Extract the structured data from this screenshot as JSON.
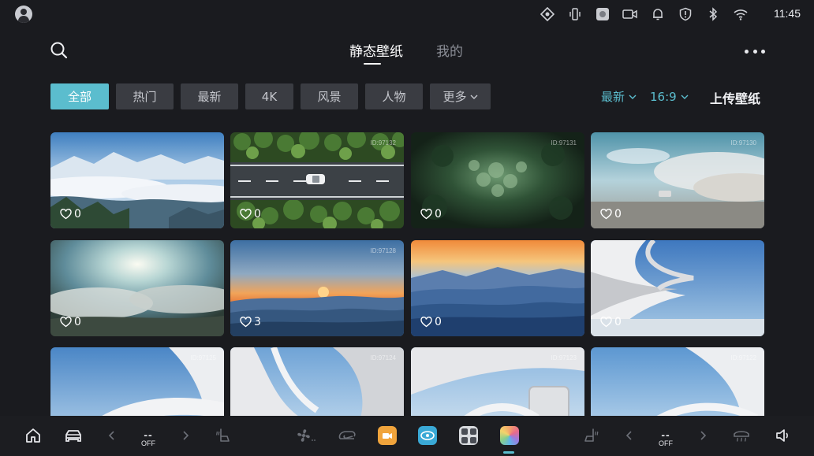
{
  "statusbar": {
    "time": "11:45",
    "icons": [
      "location-diamond-icon",
      "phone-vibrate-icon",
      "media-app-icon",
      "camera-record-icon",
      "bell-icon",
      "shield-alert-icon",
      "bluetooth-icon",
      "wifi-icon"
    ]
  },
  "header": {
    "tabs": [
      {
        "label": "静态壁纸",
        "active": true
      },
      {
        "label": "我的",
        "active": false
      }
    ]
  },
  "filters": {
    "chips": [
      "全部",
      "热门",
      "最新",
      "4K",
      "风景",
      "人物",
      "更多"
    ],
    "active_index": 0,
    "sort_label": "最新",
    "ratio_label": "16:9",
    "upload_label": "上传壁纸"
  },
  "wallpapers": [
    {
      "id": "",
      "likes": "0",
      "theme": "snowy-mountains-clouds"
    },
    {
      "id": "ID:97132",
      "likes": "0",
      "theme": "road-through-forest"
    },
    {
      "id": "ID:97131",
      "likes": "0",
      "theme": "dense-forest-aerial"
    },
    {
      "id": "ID:97130",
      "likes": "0",
      "theme": "desert-car-dust"
    },
    {
      "id": "",
      "likes": "0",
      "theme": "sun-through-clouds"
    },
    {
      "id": "ID:97128",
      "likes": "3",
      "theme": "orange-sunset-hills"
    },
    {
      "id": "",
      "likes": "0",
      "theme": "blue-mountain-layers"
    },
    {
      "id": "",
      "likes": "0",
      "theme": "white-architecture-sky"
    },
    {
      "id": "ID:97125",
      "likes": "",
      "theme": "white-architecture-arch"
    },
    {
      "id": "ID:97124",
      "likes": "",
      "theme": "white-architecture-sea"
    },
    {
      "id": "ID:97123",
      "likes": "",
      "theme": "white-architecture-window"
    },
    {
      "id": "ID:97122",
      "likes": "",
      "theme": "white-architecture-curve"
    }
  ],
  "dock": {
    "left_temp": {
      "value": "--",
      "state": "OFF"
    },
    "right_temp": {
      "value": "--",
      "state": "OFF"
    },
    "colors": {
      "accent": "#5bbdce",
      "camera_app": "#f0a43c",
      "nav_app": "#3aa9d6",
      "apps_grid": "#d8dade"
    }
  }
}
